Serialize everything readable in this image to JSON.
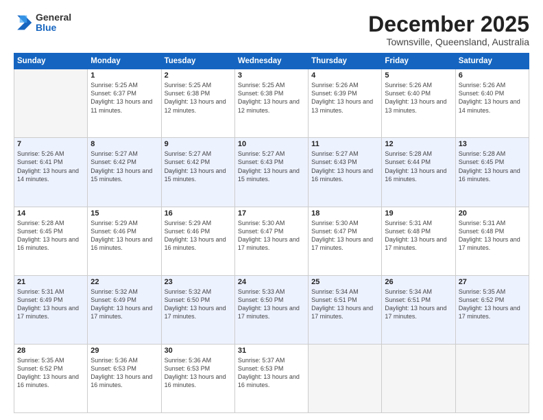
{
  "logo": {
    "general": "General",
    "blue": "Blue"
  },
  "header": {
    "month": "December 2025",
    "location": "Townsville, Queensland, Australia"
  },
  "days_of_week": [
    "Sunday",
    "Monday",
    "Tuesday",
    "Wednesday",
    "Thursday",
    "Friday",
    "Saturday"
  ],
  "weeks": [
    [
      {
        "day": "",
        "sunrise": "",
        "sunset": "",
        "daylight": ""
      },
      {
        "day": "1",
        "sunrise": "Sunrise: 5:25 AM",
        "sunset": "Sunset: 6:37 PM",
        "daylight": "Daylight: 13 hours and 11 minutes."
      },
      {
        "day": "2",
        "sunrise": "Sunrise: 5:25 AM",
        "sunset": "Sunset: 6:38 PM",
        "daylight": "Daylight: 13 hours and 12 minutes."
      },
      {
        "day": "3",
        "sunrise": "Sunrise: 5:25 AM",
        "sunset": "Sunset: 6:38 PM",
        "daylight": "Daylight: 13 hours and 12 minutes."
      },
      {
        "day": "4",
        "sunrise": "Sunrise: 5:26 AM",
        "sunset": "Sunset: 6:39 PM",
        "daylight": "Daylight: 13 hours and 13 minutes."
      },
      {
        "day": "5",
        "sunrise": "Sunrise: 5:26 AM",
        "sunset": "Sunset: 6:40 PM",
        "daylight": "Daylight: 13 hours and 13 minutes."
      },
      {
        "day": "6",
        "sunrise": "Sunrise: 5:26 AM",
        "sunset": "Sunset: 6:40 PM",
        "daylight": "Daylight: 13 hours and 14 minutes."
      }
    ],
    [
      {
        "day": "7",
        "sunrise": "Sunrise: 5:26 AM",
        "sunset": "Sunset: 6:41 PM",
        "daylight": "Daylight: 13 hours and 14 minutes."
      },
      {
        "day": "8",
        "sunrise": "Sunrise: 5:27 AM",
        "sunset": "Sunset: 6:42 PM",
        "daylight": "Daylight: 13 hours and 15 minutes."
      },
      {
        "day": "9",
        "sunrise": "Sunrise: 5:27 AM",
        "sunset": "Sunset: 6:42 PM",
        "daylight": "Daylight: 13 hours and 15 minutes."
      },
      {
        "day": "10",
        "sunrise": "Sunrise: 5:27 AM",
        "sunset": "Sunset: 6:43 PM",
        "daylight": "Daylight: 13 hours and 15 minutes."
      },
      {
        "day": "11",
        "sunrise": "Sunrise: 5:27 AM",
        "sunset": "Sunset: 6:43 PM",
        "daylight": "Daylight: 13 hours and 16 minutes."
      },
      {
        "day": "12",
        "sunrise": "Sunrise: 5:28 AM",
        "sunset": "Sunset: 6:44 PM",
        "daylight": "Daylight: 13 hours and 16 minutes."
      },
      {
        "day": "13",
        "sunrise": "Sunrise: 5:28 AM",
        "sunset": "Sunset: 6:45 PM",
        "daylight": "Daylight: 13 hours and 16 minutes."
      }
    ],
    [
      {
        "day": "14",
        "sunrise": "Sunrise: 5:28 AM",
        "sunset": "Sunset: 6:45 PM",
        "daylight": "Daylight: 13 hours and 16 minutes."
      },
      {
        "day": "15",
        "sunrise": "Sunrise: 5:29 AM",
        "sunset": "Sunset: 6:46 PM",
        "daylight": "Daylight: 13 hours and 16 minutes."
      },
      {
        "day": "16",
        "sunrise": "Sunrise: 5:29 AM",
        "sunset": "Sunset: 6:46 PM",
        "daylight": "Daylight: 13 hours and 16 minutes."
      },
      {
        "day": "17",
        "sunrise": "Sunrise: 5:30 AM",
        "sunset": "Sunset: 6:47 PM",
        "daylight": "Daylight: 13 hours and 17 minutes."
      },
      {
        "day": "18",
        "sunrise": "Sunrise: 5:30 AM",
        "sunset": "Sunset: 6:47 PM",
        "daylight": "Daylight: 13 hours and 17 minutes."
      },
      {
        "day": "19",
        "sunrise": "Sunrise: 5:31 AM",
        "sunset": "Sunset: 6:48 PM",
        "daylight": "Daylight: 13 hours and 17 minutes."
      },
      {
        "day": "20",
        "sunrise": "Sunrise: 5:31 AM",
        "sunset": "Sunset: 6:48 PM",
        "daylight": "Daylight: 13 hours and 17 minutes."
      }
    ],
    [
      {
        "day": "21",
        "sunrise": "Sunrise: 5:31 AM",
        "sunset": "Sunset: 6:49 PM",
        "daylight": "Daylight: 13 hours and 17 minutes."
      },
      {
        "day": "22",
        "sunrise": "Sunrise: 5:32 AM",
        "sunset": "Sunset: 6:49 PM",
        "daylight": "Daylight: 13 hours and 17 minutes."
      },
      {
        "day": "23",
        "sunrise": "Sunrise: 5:32 AM",
        "sunset": "Sunset: 6:50 PM",
        "daylight": "Daylight: 13 hours and 17 minutes."
      },
      {
        "day": "24",
        "sunrise": "Sunrise: 5:33 AM",
        "sunset": "Sunset: 6:50 PM",
        "daylight": "Daylight: 13 hours and 17 minutes."
      },
      {
        "day": "25",
        "sunrise": "Sunrise: 5:34 AM",
        "sunset": "Sunset: 6:51 PM",
        "daylight": "Daylight: 13 hours and 17 minutes."
      },
      {
        "day": "26",
        "sunrise": "Sunrise: 5:34 AM",
        "sunset": "Sunset: 6:51 PM",
        "daylight": "Daylight: 13 hours and 17 minutes."
      },
      {
        "day": "27",
        "sunrise": "Sunrise: 5:35 AM",
        "sunset": "Sunset: 6:52 PM",
        "daylight": "Daylight: 13 hours and 17 minutes."
      }
    ],
    [
      {
        "day": "28",
        "sunrise": "Sunrise: 5:35 AM",
        "sunset": "Sunset: 6:52 PM",
        "daylight": "Daylight: 13 hours and 16 minutes."
      },
      {
        "day": "29",
        "sunrise": "Sunrise: 5:36 AM",
        "sunset": "Sunset: 6:53 PM",
        "daylight": "Daylight: 13 hours and 16 minutes."
      },
      {
        "day": "30",
        "sunrise": "Sunrise: 5:36 AM",
        "sunset": "Sunset: 6:53 PM",
        "daylight": "Daylight: 13 hours and 16 minutes."
      },
      {
        "day": "31",
        "sunrise": "Sunrise: 5:37 AM",
        "sunset": "Sunset: 6:53 PM",
        "daylight": "Daylight: 13 hours and 16 minutes."
      },
      {
        "day": "",
        "sunrise": "",
        "sunset": "",
        "daylight": ""
      },
      {
        "day": "",
        "sunrise": "",
        "sunset": "",
        "daylight": ""
      },
      {
        "day": "",
        "sunrise": "",
        "sunset": "",
        "daylight": ""
      }
    ]
  ]
}
